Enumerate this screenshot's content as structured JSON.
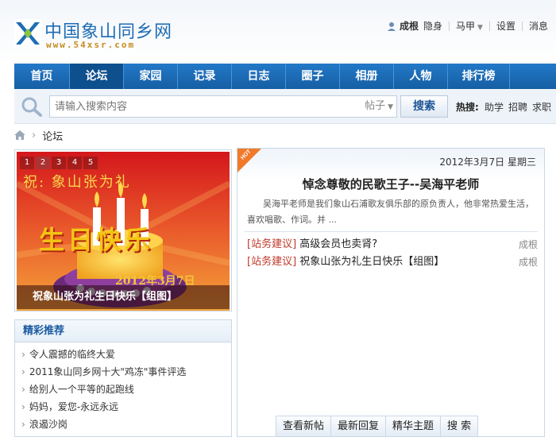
{
  "header": {
    "logo_cn": "中国象山同乡网",
    "logo_en": "www.54xsr.com",
    "user_name": "成根",
    "hide_label": "隐身",
    "mail_label": "马甲",
    "settings_label": "设置",
    "messages_label": "消息"
  },
  "nav": {
    "items": [
      {
        "label": "首页"
      },
      {
        "label": "论坛"
      },
      {
        "label": "家园"
      },
      {
        "label": "记录"
      },
      {
        "label": "日志"
      },
      {
        "label": "圈子"
      },
      {
        "label": "相册"
      },
      {
        "label": "人物"
      },
      {
        "label": "排行榜"
      }
    ],
    "active": "论坛"
  },
  "search": {
    "placeholder": "请输入搜索内容",
    "type": "帖子",
    "button": "搜索",
    "hot_label": "热搜:",
    "hot_words": [
      "助学",
      "招聘",
      "求职"
    ]
  },
  "breadcrumb": {
    "current": "论坛"
  },
  "slideshow": {
    "pages": [
      "1",
      "2",
      "3",
      "4",
      "5"
    ],
    "active_page": "2",
    "line1": "祝:  象山张为礼",
    "line2": "生日快乐",
    "date_text": "2012年3月7日",
    "caption": "祝象山张为礼生日快乐【组图】"
  },
  "featured": {
    "title": "精彩推荐",
    "items": [
      "令人震撼的临终大爱",
      "2011象山同乡网十大\"鸡冻\"事件评选",
      "给别人一个平等的起跑线",
      "妈妈，爱您-永远永远",
      "浪遏沙岗"
    ]
  },
  "panel": {
    "date": "2012年3月7日 星期三",
    "badge": "HOT",
    "headline": "悼念尊敬的民歌王子--吴海平老师",
    "summary": "吴海平老师是我们象山石浦歌友俱乐部的原负责人，他非常热爱生活，喜欢唱歌、作词。并 ...",
    "posts": [
      {
        "tag": "[站务建议]",
        "title": "高级会员也卖肾?",
        "author": "成根"
      },
      {
        "tag": "[站务建议]",
        "title": "祝象山张为礼生日快乐【组图】",
        "author": "成根"
      }
    ],
    "tabs": [
      "查看新帖",
      "最新回复",
      "精华主题",
      "搜  索"
    ]
  },
  "colors": {
    "nav_blue": "#1b6cba",
    "link_blue": "#1a5aa0",
    "tag_red": "#c0392b"
  }
}
